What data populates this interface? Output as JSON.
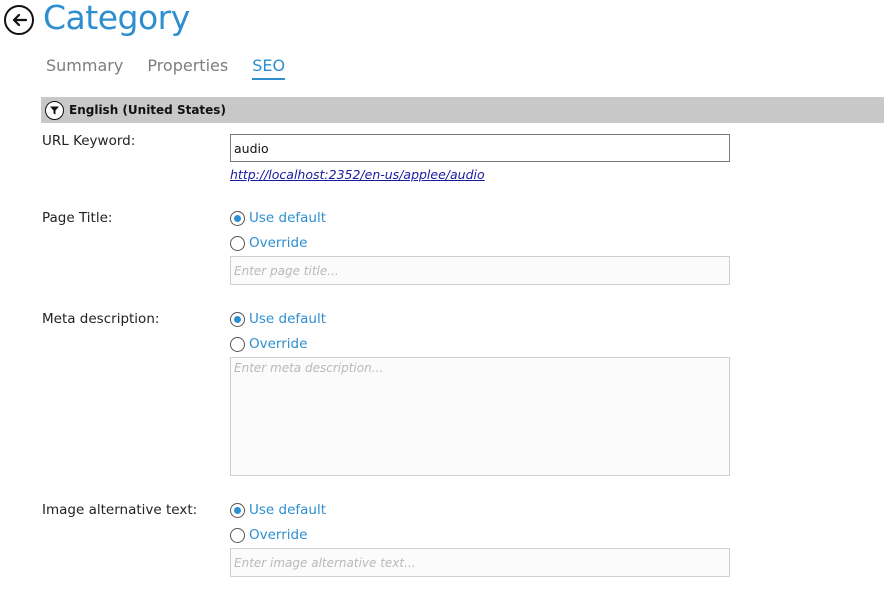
{
  "header": {
    "back_icon": "arrow-left-circle-icon",
    "title": "Category"
  },
  "tabs": [
    {
      "label": "Summary",
      "active": false
    },
    {
      "label": "Properties",
      "active": false
    },
    {
      "label": "SEO",
      "active": true
    }
  ],
  "section": {
    "icon": "filter-icon",
    "label": "English (United States)"
  },
  "url_keyword": {
    "label": "URL Keyword:",
    "value": "audio",
    "link": "http://localhost:2352/en-us/applee/audio"
  },
  "page_title": {
    "label": "Page Title:",
    "option_default": "Use default",
    "option_override": "Override",
    "selected": "Use default",
    "placeholder": "Enter page title..."
  },
  "meta_description": {
    "label": "Meta description:",
    "option_default": "Use default",
    "option_override": "Override",
    "selected": "Use default",
    "placeholder": "Enter meta description..."
  },
  "image_alt": {
    "label": "Image alternative text:",
    "option_default": "Use default",
    "option_override": "Override",
    "selected": "Use default",
    "placeholder": "Enter image alternative text..."
  },
  "colors": {
    "accent": "#2d8fd0",
    "section_bg": "#c8c8c8",
    "link": "#1a1aa0"
  }
}
